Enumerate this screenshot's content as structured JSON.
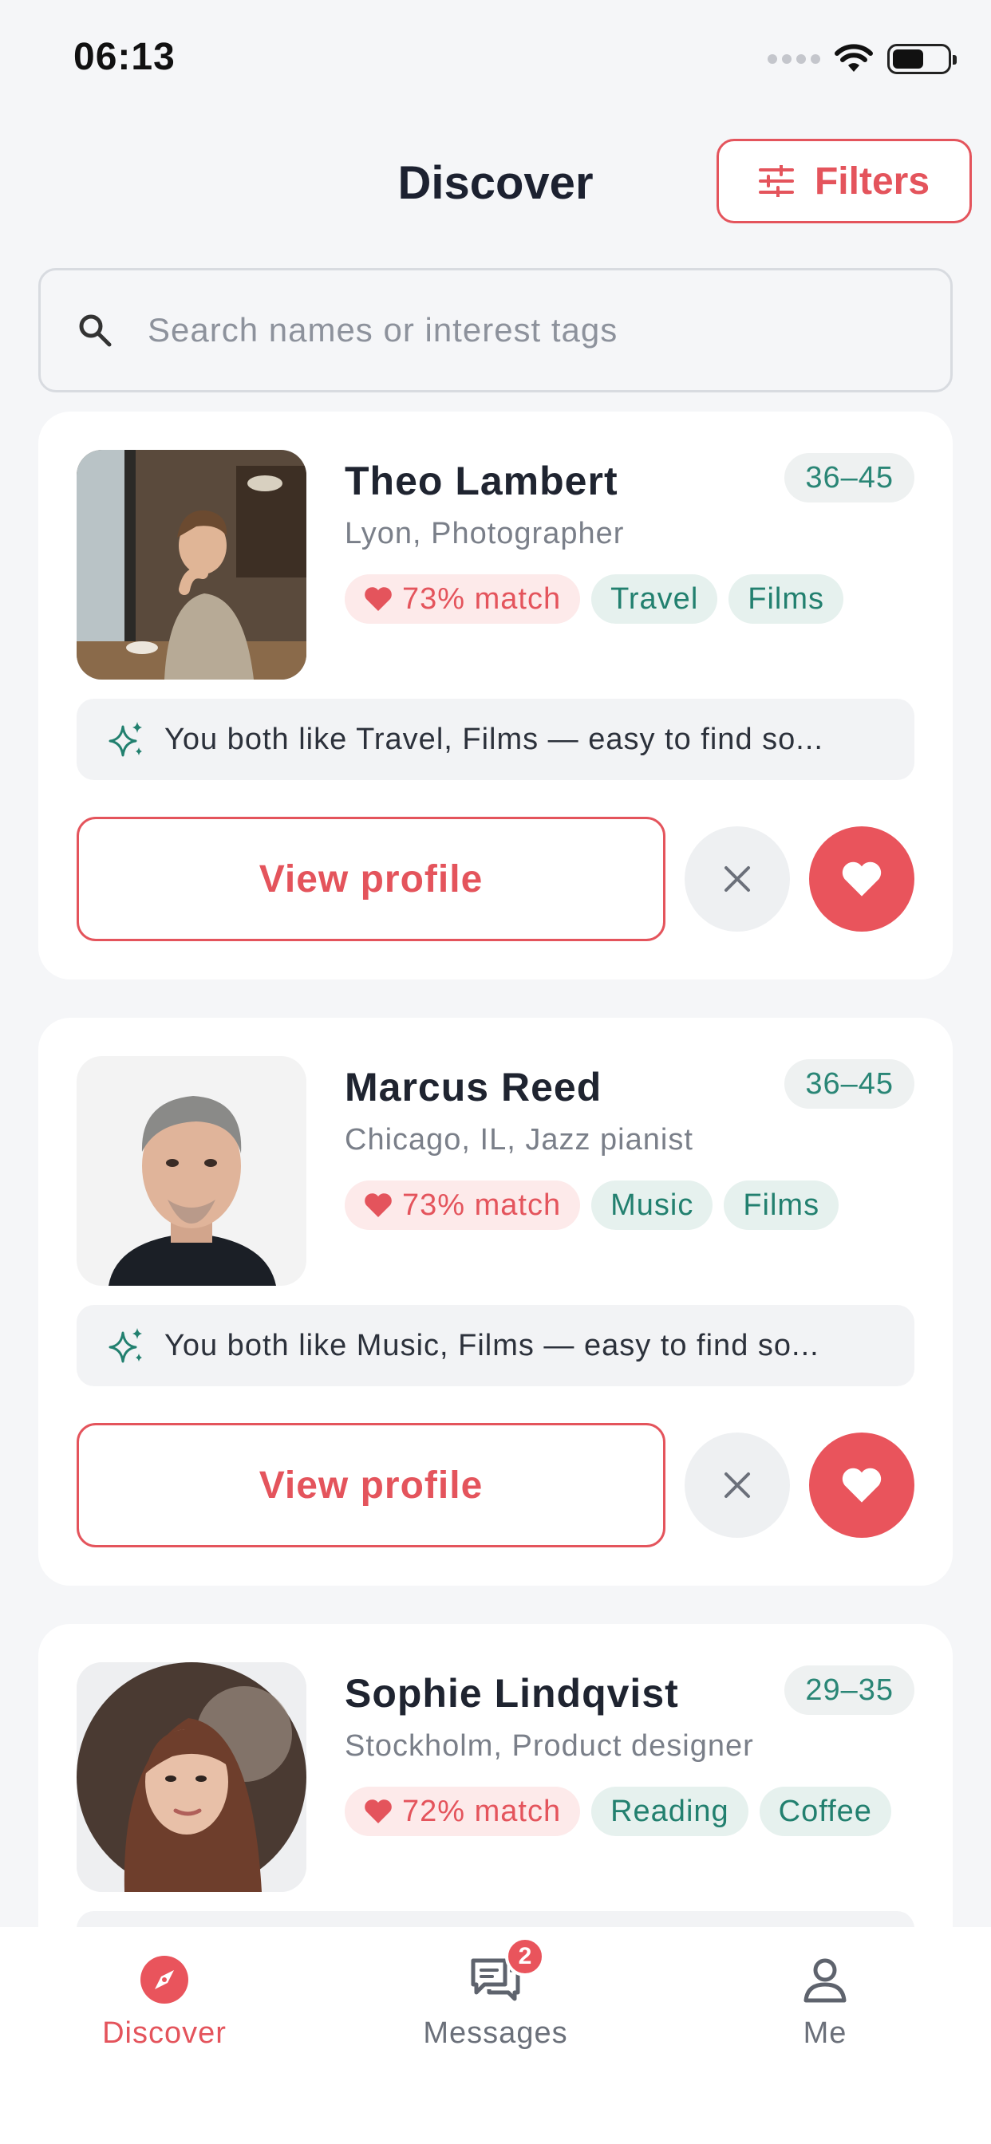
{
  "status_bar": {
    "time": "06:13"
  },
  "header": {
    "title": "Discover",
    "filters_label": "Filters"
  },
  "search": {
    "placeholder": "Search names or interest tags"
  },
  "profiles": [
    {
      "name": "Theo Lambert",
      "age_range": "36–45",
      "location": "Lyon, Photographer",
      "match": "73% match",
      "tags": [
        "Travel",
        "Films"
      ],
      "insight": "You both like Travel, Films — easy to find so...",
      "view_label": "View profile"
    },
    {
      "name": "Marcus Reed",
      "age_range": "36–45",
      "location": "Chicago, IL, Jazz pianist",
      "match": "73% match",
      "tags": [
        "Music",
        "Films"
      ],
      "insight": "You both like Music, Films — easy to find so...",
      "view_label": "View profile"
    },
    {
      "name": "Sophie Lindqvist",
      "age_range": "29–35",
      "location": "Stockholm, Product designer",
      "match": "72% match",
      "tags": [
        "Reading",
        "Coffee"
      ],
      "insight": "",
      "view_label": ""
    }
  ],
  "bottom_nav": {
    "items": [
      {
        "label": "Discover",
        "icon": "compass-icon",
        "active": true
      },
      {
        "label": "Messages",
        "icon": "chat-icon",
        "badge": "2"
      },
      {
        "label": "Me",
        "icon": "person-icon"
      }
    ]
  },
  "colors": {
    "accent": "#e4545c",
    "tag_green": "#22806f",
    "background": "#f5f6f8"
  }
}
